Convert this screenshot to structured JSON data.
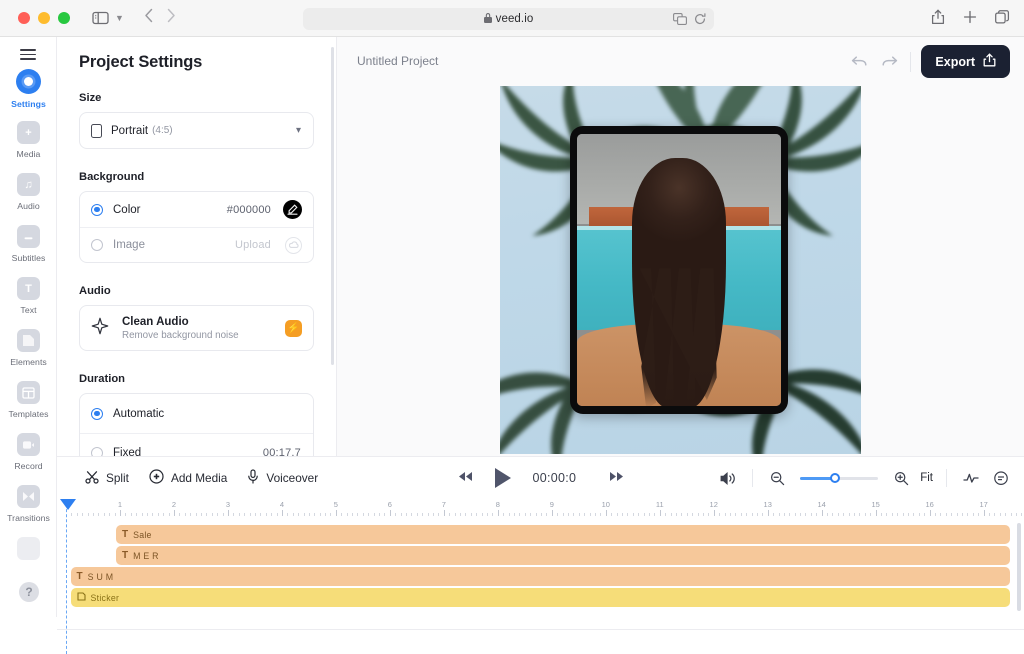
{
  "browser": {
    "url": "veed.io",
    "lock_icon": "lock-icon",
    "sidebar_toggle_icon": "sidebar-toggle-icon",
    "back_icon": "chevron-left-icon",
    "forward_icon": "chevron-right-icon",
    "shield_icon": "shield-icon",
    "translate_icon": "translate-icon",
    "reload_icon": "reload-icon",
    "share_icon": "share-icon",
    "new_tab_icon": "plus-icon",
    "tabs_icon": "copy-tabs-icon"
  },
  "rail": {
    "menu_icon": "hamburger-menu-icon",
    "help_label": "?",
    "items": [
      {
        "label": "Settings",
        "icon": "settings-ring-icon",
        "active": true
      },
      {
        "label": "Media",
        "icon": "plus-square-icon",
        "active": false
      },
      {
        "label": "Audio",
        "icon": "music-note-icon",
        "active": false
      },
      {
        "label": "Subtitles",
        "icon": "subtitles-icon",
        "active": false
      },
      {
        "label": "Text",
        "icon": "text-t-icon",
        "active": false
      },
      {
        "label": "Elements",
        "icon": "shapes-icon",
        "active": false
      },
      {
        "label": "Templates",
        "icon": "layout-grid-icon",
        "active": false
      },
      {
        "label": "Record",
        "icon": "video-camera-icon",
        "active": false
      },
      {
        "label": "Transitions",
        "icon": "transitions-icon",
        "active": false
      }
    ]
  },
  "panel": {
    "title": "Project Settings",
    "sections": {
      "size": {
        "label": "Size",
        "icon": "portrait-frame-icon",
        "value": "Portrait",
        "ratio": "(4:5)",
        "chevron": "chevron-down-icon"
      },
      "background": {
        "label": "Background",
        "color_option": "Color",
        "color_value": "#000000",
        "color_selected": true,
        "swatch_hex": "#000000",
        "eyedropper_icon": "eyedropper-icon",
        "image_option": "Image",
        "image_placeholder": "Upload",
        "image_selected": false,
        "upload_icon": "upload-cloud-icon"
      },
      "audio": {
        "label": "Audio",
        "feature_title": "Clean Audio",
        "feature_subtitle": "Remove background noise",
        "sparkle_icon": "sparkle-icon",
        "badge_icon": "pro-bolt-icon",
        "badge_color": "#f59e24"
      },
      "duration": {
        "label": "Duration",
        "automatic_option": "Automatic",
        "automatic_selected": true,
        "fixed_option": "Fixed",
        "fixed_value": "00:17.7",
        "fixed_selected": false
      }
    }
  },
  "header": {
    "project_title": "Untitled Project",
    "undo_icon": "undo-arrow-icon",
    "redo_icon": "redo-arrow-icon",
    "export_label": "Export",
    "export_icon": "export-upload-icon",
    "export_bg": "#1b2132"
  },
  "toolbar": {
    "split_label": "Split",
    "split_icon": "scissors-icon",
    "add_media_label": "Add Media",
    "add_media_icon": "plus-circle-icon",
    "voiceover_label": "Voiceover",
    "voiceover_icon": "microphone-icon",
    "rewind_icon": "rewind-icon",
    "play_icon": "play-triangle-icon",
    "forward_icon": "fast-forward-icon",
    "timecode": "00:00:0",
    "volume_icon": "volume-icon",
    "zoom_out_icon": "zoom-out-icon",
    "zoom_in_icon": "zoom-in-icon",
    "zoom_percent": 45,
    "fit_label": "Fit",
    "waveform_icon": "waveform-icon",
    "caption_icon": "caption-bubble-icon"
  },
  "timeline": {
    "playhead_position": "0",
    "ruler_ticks": [
      "1",
      "2",
      "3",
      "4",
      "5",
      "6",
      "7",
      "8",
      "9",
      "10",
      "11",
      "12",
      "13",
      "14",
      "15",
      "16",
      "17"
    ],
    "tracks": [
      {
        "label": "Sale",
        "type": "text",
        "glyph": "T",
        "start_pct": 6.1,
        "width_pct": 92.5,
        "color": "#f6c89a"
      },
      {
        "label": "M E R",
        "type": "text",
        "glyph": "T",
        "start_pct": 6.1,
        "width_pct": 92.5,
        "color": "#f6c89a"
      },
      {
        "label": "S U M",
        "type": "text",
        "glyph": "T",
        "start_pct": 1.4,
        "width_pct": 97.2,
        "color": "#f6c89a"
      },
      {
        "label": "Sticker",
        "type": "sticker",
        "glyph": "S",
        "start_pct": 1.4,
        "width_pct": 97.2,
        "color": "#f6dd79"
      }
    ]
  }
}
